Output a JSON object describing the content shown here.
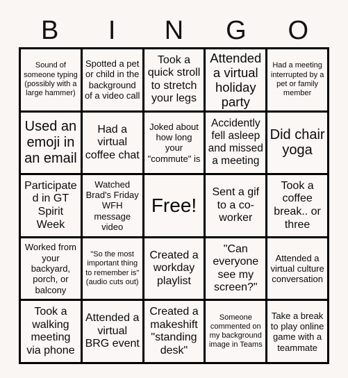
{
  "card": {
    "title": "BINGO",
    "header_letters": [
      "B",
      "I",
      "N",
      "G",
      "O"
    ],
    "colors": {
      "page_background": "#faf6f4",
      "cell_background": "#faf7f5",
      "border": "#000000",
      "text": "#0a0a0a"
    },
    "grid_size": "5x5",
    "rows": [
      {
        "cells": [
          {
            "text": "Sound of someone typing (possibly with a large hammer)",
            "size": "xs",
            "free": false
          },
          {
            "text": "Spotted a pet or child in the background of a video call",
            "size": "sm",
            "free": false
          },
          {
            "text": "Took a quick stroll to stretch your legs",
            "size": "md",
            "free": false
          },
          {
            "text": "Attended a virtual holiday party",
            "size": "lg",
            "free": false
          },
          {
            "text": "Had a meeting interrupted by a pet or family member",
            "size": "xs",
            "free": false
          }
        ]
      },
      {
        "cells": [
          {
            "text": "Used an emoji in an email",
            "size": "lg",
            "free": false
          },
          {
            "text": "Had a virtual coffee chat",
            "size": "md",
            "free": false
          },
          {
            "text": "Joked about how long your \"commute\" is",
            "size": "sm",
            "free": false
          },
          {
            "text": "Accidently fell asleep and missed a meeting",
            "size": "md",
            "free": false
          },
          {
            "text": "Did chair yoga",
            "size": "lg",
            "free": false
          }
        ]
      },
      {
        "cells": [
          {
            "text": "Participated in GT Spirit Week",
            "size": "md",
            "free": false
          },
          {
            "text": "Watched Brad's Friday WFH message video",
            "size": "sm",
            "free": false
          },
          {
            "text": "Free!",
            "size": "xl",
            "free": true
          },
          {
            "text": "Sent a gif to a co-worker",
            "size": "md",
            "free": false
          },
          {
            "text": "Took a coffee break.. or three",
            "size": "md",
            "free": false
          }
        ]
      },
      {
        "cells": [
          {
            "text": "Worked from your backyard, porch, or balcony",
            "size": "sm",
            "free": false
          },
          {
            "text": "\"So the most important thing to remember is\" (audio cuts out)",
            "size": "xs",
            "free": false
          },
          {
            "text": "Created a workday playlist",
            "size": "md",
            "free": false
          },
          {
            "text": "\"Can everyone see my screen?\"",
            "size": "md",
            "free": false
          },
          {
            "text": "Attended a virtual culture conversation",
            "size": "sm",
            "free": false
          }
        ]
      },
      {
        "cells": [
          {
            "text": "Took a walking meeting via phone",
            "size": "md",
            "free": false
          },
          {
            "text": "Attended a virtual BRG event",
            "size": "md",
            "free": false
          },
          {
            "text": "Created a makeshift \"standing desk\"",
            "size": "md",
            "free": false
          },
          {
            "text": "Someone commented on my background image in Teams",
            "size": "xs",
            "free": false
          },
          {
            "text": "Take a break to play online game with a teammate",
            "size": "sm",
            "free": false
          }
        ]
      }
    ]
  }
}
